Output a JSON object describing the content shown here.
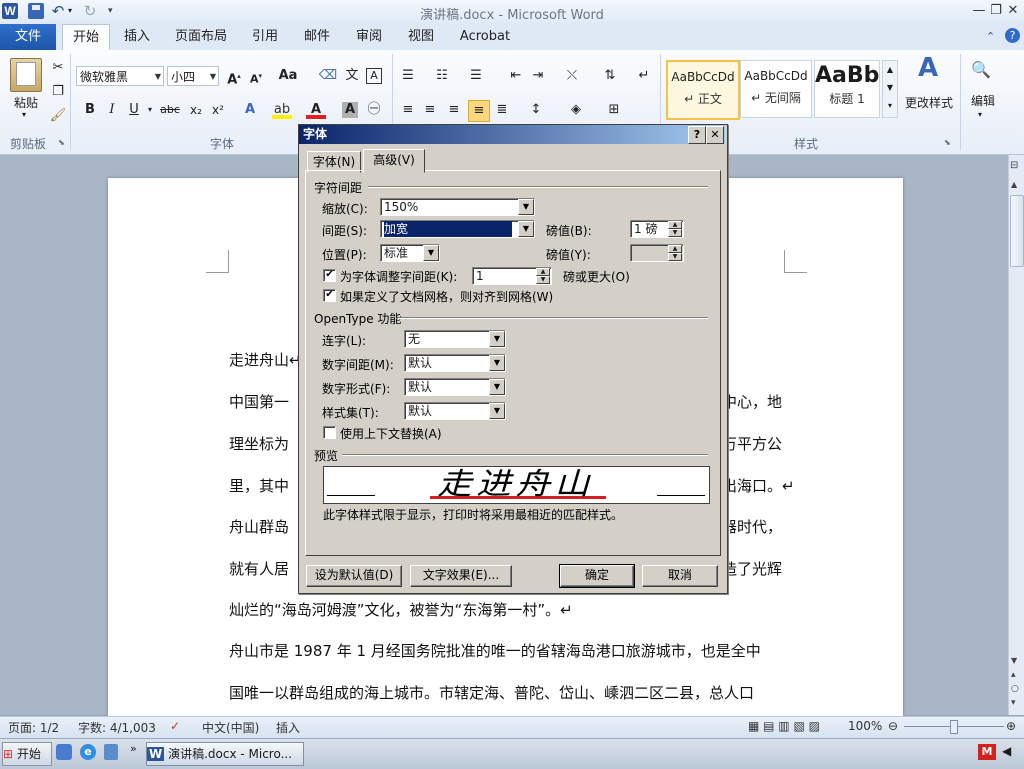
{
  "window": {
    "title": "演讲稿.docx - Microsoft Word",
    "quick_access": {
      "word_icon": "W"
    },
    "controls": {
      "minimize": "—",
      "restore": "❐",
      "close": "✕"
    }
  },
  "ribbon_tabs": {
    "file": "文件",
    "home": "开始",
    "insert": "插入",
    "page_layout": "页面布局",
    "references": "引用",
    "mailings": "邮件",
    "review": "审阅",
    "view": "视图",
    "acrobat": "Acrobat"
  },
  "ribbon": {
    "clipboard": {
      "label": "剪贴板",
      "paste": "粘贴"
    },
    "font": {
      "label": "字体",
      "name": "微软雅黑",
      "size": "小四"
    },
    "styles": {
      "label": "样式",
      "items": [
        {
          "sample": "AaBbCcDd",
          "name": "↵ 正文"
        },
        {
          "sample": "AaBbCcDd",
          "name": "↵ 无间隔"
        },
        {
          "sample": "AaBb",
          "name": "标题 1"
        }
      ],
      "change_styles": "更改样式"
    },
    "editing": {
      "label": "编辑"
    }
  },
  "document": {
    "paragraphs": [
      "走进舟山↵",
      "中国第一",
      "中心，地",
      "理坐标为",
      "万平方公",
      "里，其中",
      "出海口。↵",
      "舟山群岛",
      "器时代，",
      "就有人居",
      "造了光辉",
      "灿烂的“海岛河姆渡”文化，被誉为“东海第一村”。↵",
      "舟山市是 1987 年 1 月经国务院批准的唯一的省辖海岛港口旅游城市，也是全中",
      "国唯一以群岛组成的海上城市。市辖定海、普陀、岱山、嵊泗二区二县，总人口"
    ]
  },
  "font_dialog": {
    "title": "字体",
    "help": "?",
    "close": "✕",
    "tabs": {
      "font": "字体(N)",
      "advanced": "高级(V)"
    },
    "char_spacing": {
      "section": "字符间距",
      "scale_label": "缩放(C):",
      "scale_value": "150%",
      "spacing_label": "间距(S):",
      "spacing_value": "加宽",
      "spacing_pt_label": "磅值(B):",
      "spacing_pt_value": "1 磅",
      "position_label": "位置(P):",
      "position_value": "标准",
      "position_pt_label": "磅值(Y):",
      "position_pt_value": "",
      "kerning_label": "为字体调整字间距(K):",
      "kerning_checked": "✔",
      "kerning_value": "1",
      "kerning_suffix": "磅或更大(O)",
      "grid_label": "如果定义了文档网格，则对齐到网格(W)",
      "grid_checked": "✔"
    },
    "opentype": {
      "section": "OpenType 功能",
      "ligatures_label": "连字(L):",
      "ligatures_value": "无",
      "num_spacing_label": "数字间距(M):",
      "num_spacing_value": "默认",
      "num_forms_label": "数字形式(F):",
      "num_forms_value": "默认",
      "style_set_label": "样式集(T):",
      "style_set_value": "默认",
      "contextual_label": "使用上下文替换(A)"
    },
    "preview": {
      "section": "预览",
      "text": "走进舟山",
      "note": "此字体样式限于显示，打印时将采用最相近的匹配样式。"
    },
    "buttons": {
      "set_default": "设为默认值(D)",
      "text_effects": "文字效果(E)...",
      "ok": "确定",
      "cancel": "取消"
    }
  },
  "status_bar": {
    "page": "页面: 1/2",
    "words": "字数: 4/1,003",
    "language": "中文(中国)",
    "mode": "插入",
    "zoom": "100%"
  },
  "taskbar": {
    "start": "开始",
    "task": "演讲稿.docx - Micro..."
  },
  "colors": {
    "accent": "#2b579a",
    "dialog_title": "#0a246a",
    "dialog_face": "#d4d0c8"
  }
}
